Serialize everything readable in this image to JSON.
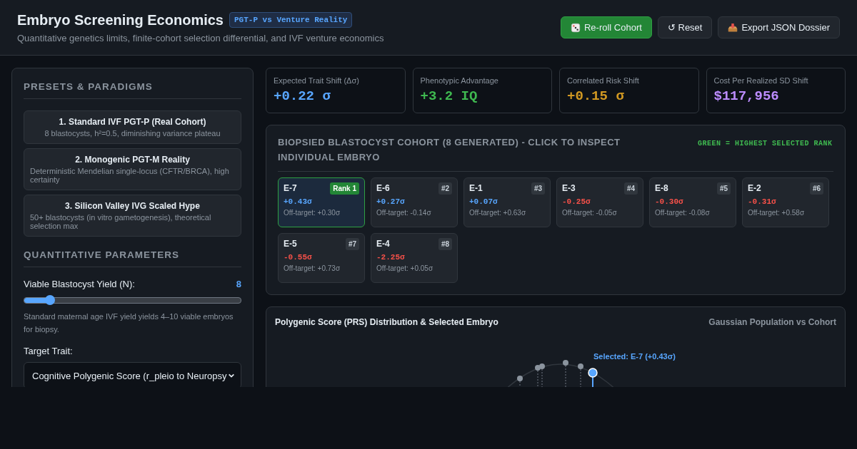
{
  "header": {
    "title": "Embryo Screening Economics",
    "badge": "PGT-P vs Venture Reality",
    "subtitle": "Quantitative genetics limits, finite-cohort selection differential, and IVF venture economics",
    "buttons": [
      {
        "kind": "primary",
        "label": "Re-roll Cohort"
      },
      {
        "kind": "secondary",
        "label": "↺ Reset"
      },
      {
        "kind": "secondary",
        "label": "Export JSON Dossier"
      }
    ]
  },
  "sidebar": {
    "presets_title": "PRESETS & PARADIGMS",
    "presets": [
      {
        "title": "1. Standard IVF PGT-P (Real Cohort)",
        "description": "8 blastocysts, h²=0.5, diminishing variance plateau"
      },
      {
        "title": "2. Monogenic PGT-M Reality",
        "description": "Deterministic Mendelian single-locus (CFTR/BRCA), high certainty"
      },
      {
        "title": "3. Silicon Valley IVG Scaled Hype",
        "description": "50+ blastocysts (in vitro gametogenesis), theoretical selection max"
      }
    ],
    "params_title": "QUANTITATIVE PARAMETERS",
    "yield": {
      "label": "Viable Blastocyst Yield (N):",
      "value": "8",
      "level": 0.12,
      "hint": "Standard maternal age IVF yield yields 4–10 viable embryos for biopsy."
    },
    "trait": {
      "label": "Target Trait:",
      "value": "Cognitive Polygenic Score (r_pleio to Neuropsy"
    }
  },
  "metrics": [
    {
      "label": "Expected Trait Shift (Δσ)",
      "value": "+0.22 σ",
      "color": "#58a6ff"
    },
    {
      "label": "Phenotypic Advantage",
      "value": "+3.2 IQ",
      "color": "#3fb950"
    },
    {
      "label": "Correlated Risk Shift",
      "value": "+0.15 σ",
      "color": "#d29922"
    },
    {
      "label": "Cost Per Realized SD Shift",
      "value": "$117,956",
      "color": "#bc8cff"
    }
  ],
  "cohort": {
    "title": "BIOPSIED BLASTOCYST COHORT (8 GENERATED) - CLICK TO INSPECT INDIVIDUAL EMBRYO",
    "legend": "GREEN = HIGHEST SELECTED RANK",
    "embryos": [
      {
        "id": "E-7",
        "rank": "Rank 1",
        "score": "+0.43σ",
        "kind": "positive",
        "off_target": "Off-target: +0.30σ",
        "selected": true
      },
      {
        "id": "E-6",
        "rank": "#2",
        "score": "+0.27σ",
        "kind": "positive",
        "off_target": "Off-target: -0.14σ",
        "selected": false
      },
      {
        "id": "E-1",
        "rank": "#3",
        "score": "+0.07σ",
        "kind": "positive",
        "off_target": "Off-target: +0.63σ",
        "selected": false
      },
      {
        "id": "E-3",
        "rank": "#4",
        "score": "-0.25σ",
        "kind": "negative",
        "off_target": "Off-target: -0.05σ",
        "selected": false
      },
      {
        "id": "E-8",
        "rank": "#5",
        "score": "-0.30σ",
        "kind": "negative",
        "off_target": "Off-target: -0.08σ",
        "selected": false
      },
      {
        "id": "E-2",
        "rank": "#6",
        "score": "-0.31σ",
        "kind": "negative",
        "off_target": "Off-target: +0.58σ",
        "selected": false
      },
      {
        "id": "E-5",
        "rank": "#7",
        "score": "-0.55σ",
        "kind": "negative",
        "off_target": "Off-target: +0.73σ",
        "selected": false
      },
      {
        "id": "E-4",
        "rank": "#8",
        "score": "-2.25σ",
        "kind": "negative",
        "off_target": "Off-target: +0.05σ",
        "selected": false
      }
    ]
  },
  "distribution": {
    "title": "Polygenic Score (PRS) Distribution & Selected Embryo",
    "subtitle": "Gaussian Population vs Cohort",
    "selected_label": "Selected: E-7 (+0.43σ)"
  }
}
